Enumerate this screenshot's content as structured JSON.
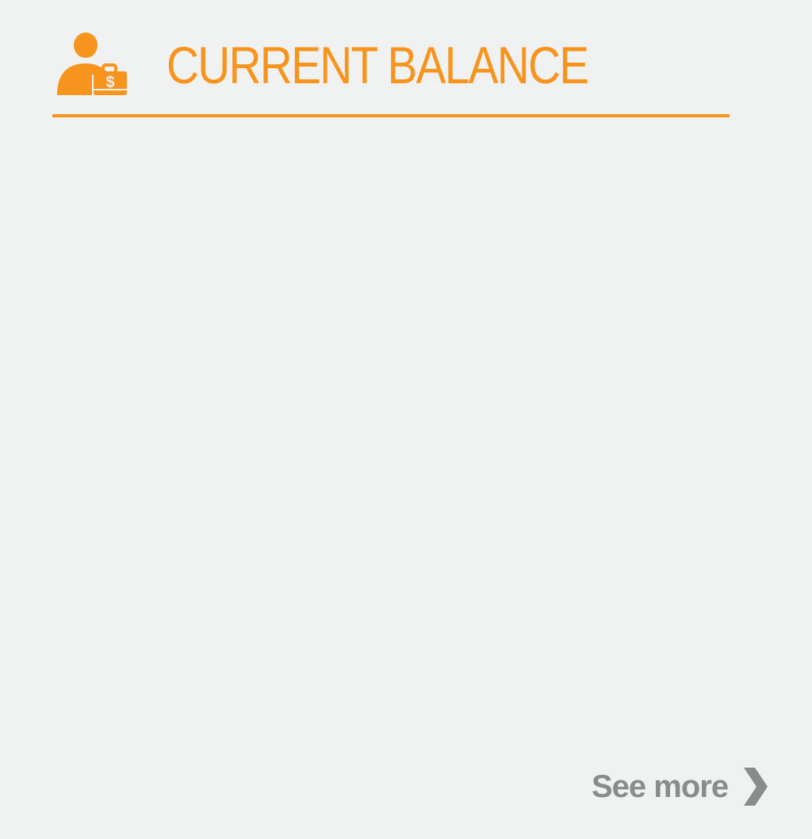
{
  "widget": {
    "title": "CURRENT BALANCE",
    "header_icon": "user-balance-icon",
    "accent_color": "#f7941d",
    "background_color": "#f0f1f1"
  },
  "footer": {
    "see_more_label": "See more",
    "see_more_icon": "chevron-right-icon",
    "link_color": "#8a8b8d"
  }
}
